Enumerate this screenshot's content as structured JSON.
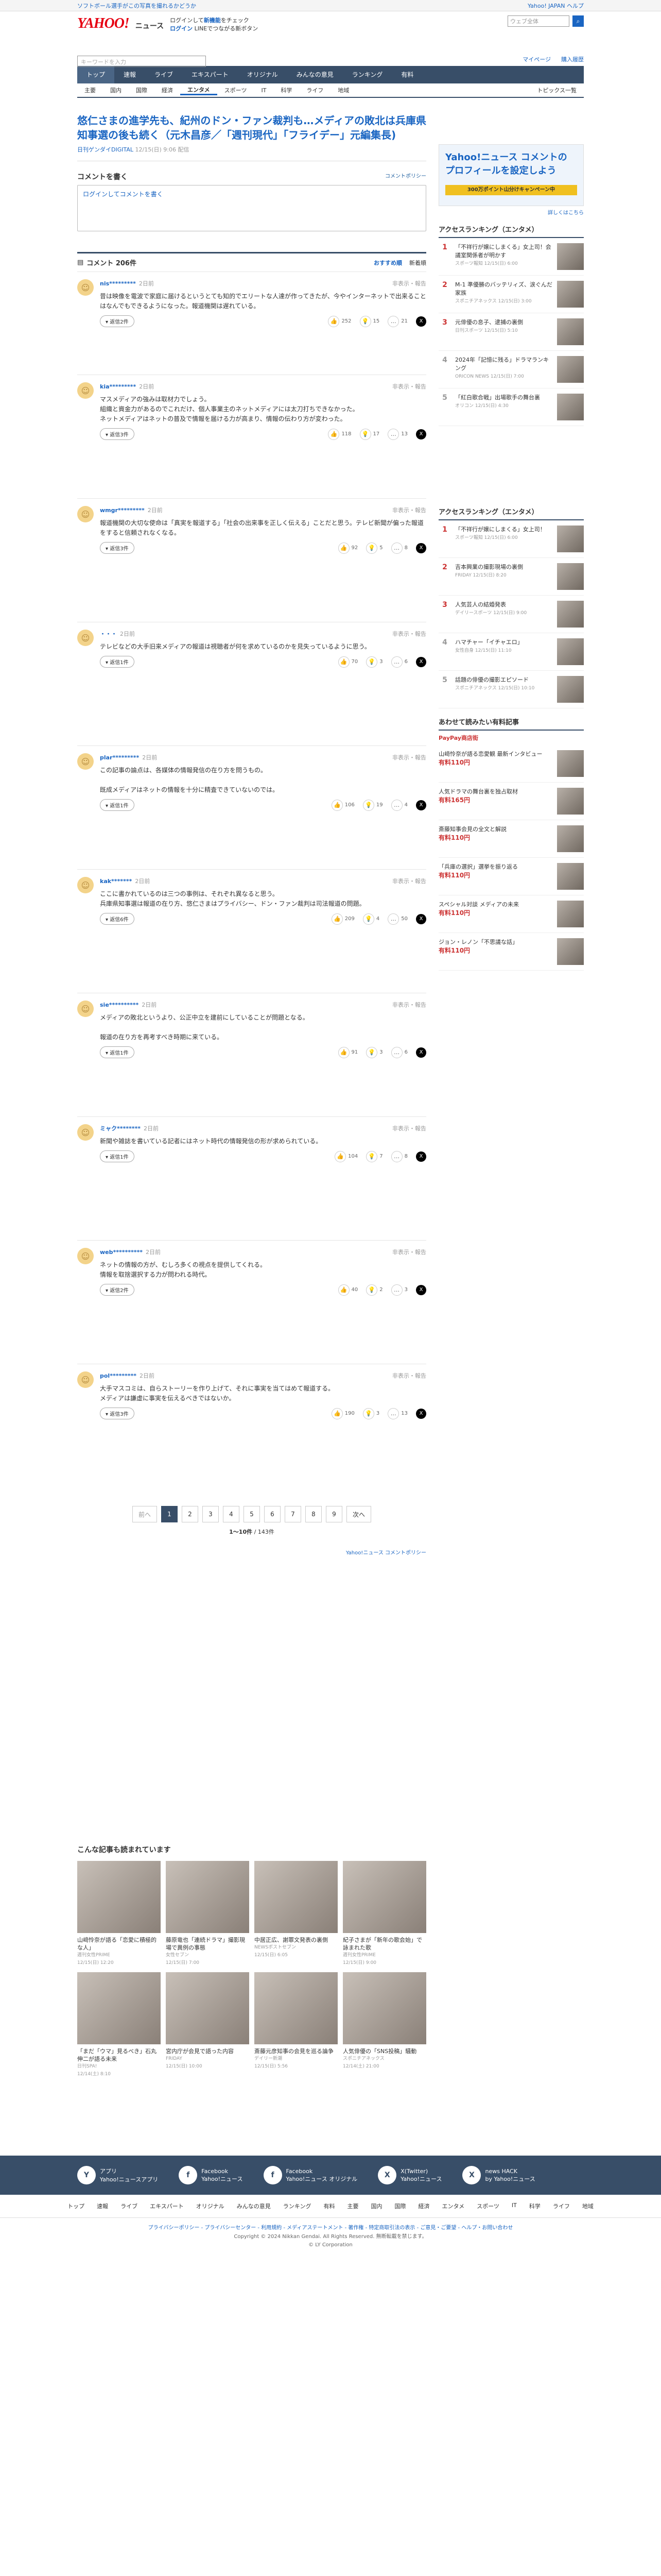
{
  "topbar": {
    "left": "ソフトボール選手がこの写真を撮れるかどうか",
    "right_login": "Yahoo! JAPAN ヘルプ",
    "search_placeholder": "ウェブ全体",
    "search_btn": "検索"
  },
  "header": {
    "logo": "YAHOO!",
    "logo_sub": "ニュース",
    "promo_line1": "ログインして",
    "promo_link1": "新機能",
    "promo_line2": "をチェック",
    "login": "ログイン",
    "login_note": "LINEでつながる新ボタン",
    "kw_label": "キーワード",
    "search_place": "キーワードを入力",
    "myhub": "マイページ",
    "reg": "購入履歴"
  },
  "nav": [
    "トップ",
    "速報",
    "ライブ",
    "エキスパート",
    "オリジナル",
    "みんなの意見",
    "ランキング",
    "有料"
  ],
  "cats": [
    "主要",
    "国内",
    "国際",
    "経済",
    "エンタメ",
    "スポーツ",
    "IT",
    "科学",
    "ライフ",
    "地域"
  ],
  "cats_right": "トピックス一覧",
  "article": {
    "title": "悠仁さまの進学先も、紀州のドン・ファン裁判も…メディアの敗北は兵庫県知事選の後も続く（元木昌彦／「週刊現代」「フライデー」元編集長)",
    "source": "日刊ゲンダイDIGITAL",
    "time": "12/15(日) 9:06 配信"
  },
  "comment_section": {
    "title": "コメントを書く",
    "policy": "コメントポリシー",
    "login_prompt": "ログインしてコメントを書く",
    "count_label": "コメント 206件",
    "sort1": "おすすめ順",
    "sort2": "新着順"
  },
  "comments": [
    {
      "user": "nis*********",
      "time": "2日前",
      "report": "非表示・報告",
      "text": "昔は映像を電波で家庭に届けるというとても知的でエリートな人達が作ってきたが、今やインターネットで出来ることはなんでもできるようになった。報道機関は遅れている。",
      "r1": "252",
      "r2": "15",
      "r3": "21",
      "replies": "返信2件"
    },
    {
      "user": "kia*********",
      "time": "2日前",
      "report": "非表示・報告",
      "text": "マスメディアの強みは取材力でしょう。\n組織と資金力があるのでこれだけ、個人事業主のネットメディアには太刀打ちできなかった。\nネットメディアはネットの普及で情報を届ける力が高まり、情報の伝わり方が変わった。",
      "r1": "118",
      "r2": "17",
      "r3": "13",
      "replies": "返信3件"
    },
    {
      "user": "wmgr*********",
      "time": "2日前",
      "report": "非表示・報告",
      "text": "報道機関の大切な使命は「真実を報道する」「社会の出来事を正しく伝える」ことだと思う。テレビ新聞が偏った報道をすると信頼されなくなる。",
      "r1": "92",
      "r2": "5",
      "r3": "8",
      "replies": "返信3件"
    },
    {
      "user": "・・・",
      "time": "2日前",
      "report": "非表示・報告",
      "text": "テレビなどの大手旧来メディアの報道は視聴者が何を求めているのかを見失っているように思う。",
      "r1": "70",
      "r2": "3",
      "r3": "6",
      "replies": "返信1件"
    },
    {
      "user": "plar*********",
      "time": "2日前",
      "report": "非表示・報告",
      "text": "この記事の論点は、各媒体の情報発信の在り方を問うもの。\n\n既成メディアはネットの情報を十分に精査できていないのでは。",
      "r1": "106",
      "r2": "19",
      "r3": "4",
      "replies": "返信1件"
    },
    {
      "user": "kak*******",
      "time": "2日前",
      "report": "非表示・報告",
      "text": "ここに書かれているのは三つの事例は、それぞれ異なると思う。\n兵庫県知事選は報道の在り方、悠仁さまはプライバシー、ドン・ファン裁判は司法報道の問題。",
      "r1": "209",
      "r2": "4",
      "r3": "50",
      "replies": "返信6件"
    },
    {
      "user": "sie**********",
      "time": "2日前",
      "report": "非表示・報告",
      "text": "メディアの敗北というより、公正中立を建前にしていることが問題となる。\n\n報道の在り方を再考すべき時期に来ている。",
      "r1": "91",
      "r2": "3",
      "r3": "6",
      "replies": "返信1件"
    },
    {
      "user": "ミャク********",
      "time": "2日前",
      "report": "非表示・報告",
      "text": "新聞や雑誌を書いている記者にはネット時代の情報発信の形が求められている。",
      "r1": "104",
      "r2": "7",
      "r3": "8",
      "replies": "返信1件"
    },
    {
      "user": "web**********",
      "time": "2日前",
      "report": "非表示・報告",
      "text": "ネットの情報の方が、むしろ多くの視点を提供してくれる。\n情報を取捨選択する力が問われる時代。",
      "r1": "40",
      "r2": "2",
      "r3": "3",
      "replies": "返信2件"
    },
    {
      "user": "pol*********",
      "time": "2日前",
      "report": "非表示・報告",
      "text": "大手マスコミは、自らストーリーを作り上げて、それに事実を当てはめて報道する。\nメディアは謙虚に事実を伝えるべきではないか。",
      "r1": "190",
      "r2": "3",
      "r3": "13",
      "replies": "返信3件"
    }
  ],
  "pager": {
    "prev": "前へ",
    "pages": [
      "1",
      "2",
      "3",
      "4",
      "5",
      "6",
      "7",
      "8",
      "9"
    ],
    "next": "次へ",
    "info_range": "1〜10件",
    "info_total": "/ 143件",
    "footer_link": "Yahoo!ニュース コメントポリシー"
  },
  "recommend": {
    "title": "こんな記事も読まれています",
    "items": [
      {
        "title": "山﨑怜奈が語る「恋愛に積極的な人」",
        "src": "週刊女性PRIME",
        "time": "12/15(日) 12:20"
      },
      {
        "title": "藤原竜也「連続ドラマ」撮影現場で異例の事態",
        "src": "女性セブン",
        "time": "12/15(日) 7:00"
      },
      {
        "title": "中居正広、謝罪文発表の裏側",
        "src": "NEWSポストセブン",
        "time": "12/15(日) 6:05"
      },
      {
        "title": "紀子さまが「新年の歌会始」で詠まれた歌",
        "src": "週刊女性PRIME",
        "time": "12/15(日) 9:00"
      },
      {
        "title": "「まだ「ウマ」見るべき」石丸伸二が語る未来",
        "src": "日刊SPA!",
        "time": "12/14(土) 8:10"
      },
      {
        "title": "宮内庁が会見で語った内容",
        "src": "FRIDAY",
        "time": "12/15(日) 10:00"
      },
      {
        "title": "斎藤元彦知事の会見を巡る論争",
        "src": "デイリー新潮",
        "time": "12/15(日) 5:56"
      },
      {
        "title": "人気俳優の「SNS投稿」騒動",
        "src": "スポニチアネックス",
        "time": "12/14(土) 21:00"
      }
    ]
  },
  "side": {
    "banner_title": "Yahoo!ニュース コメントの プロフィールを設定しよう",
    "banner_btn": "300万ポイント山分けキャンペーン中",
    "ad_link": "詳しくはこちら",
    "rank1_title": "アクセスランキング（エンタメ）",
    "rank1": [
      {
        "no": "1",
        "title": "「不祥行が嬢にしまくる」女上司！会議室関係者が明かす",
        "src": "スポーツ報知",
        "time": "12/15(日) 6:00"
      },
      {
        "no": "2",
        "title": "M-1 準優勝のバッテリィズ、涙ぐんだ家族",
        "src": "スポニチアネックス",
        "time": "12/15(日) 3:00"
      },
      {
        "no": "3",
        "title": "元俳優の息子、逮捕の裏側",
        "src": "日刊スポーツ",
        "time": "12/15(日) 5:10"
      },
      {
        "no": "4",
        "title": "2024年「記憶に残る」ドラマランキング",
        "src": "ORICON NEWS",
        "time": "12/15(日) 7:00"
      },
      {
        "no": "5",
        "title": "「紅白歌合戦」出場歌手の舞台裏",
        "src": "オリコン",
        "time": "12/15(日) 4:30"
      }
    ],
    "rank2_title": "アクセスランキング（エンタメ）",
    "rank2": [
      {
        "no": "1",
        "title": "「不祥行が嬢にしまくる」女上司！",
        "src": "スポーツ報知",
        "time": "12/15(日) 6:00"
      },
      {
        "no": "2",
        "title": "吉本興業の撮影現場の裏側",
        "src": "FRIDAY",
        "time": "12/15(日) 8:20"
      },
      {
        "no": "3",
        "title": "人気芸人の結婚発表",
        "src": "デイリースポーツ",
        "time": "12/15(日) 9:00"
      },
      {
        "no": "4",
        "title": "ハマチャー「イチャエロ」",
        "src": "女性自身",
        "time": "12/15(日) 11:10"
      },
      {
        "no": "5",
        "title": "話題の俳優の撮影エピソード",
        "src": "スポニチアネックス",
        "time": "12/15(日) 10:10"
      }
    ],
    "ad_title": "あわせて読みたい有料記事",
    "ad_brand": "PayPay商店街",
    "ads": [
      {
        "title": "山﨑怜奈が語る恋愛観 最新インタビュー",
        "price": "有料110円"
      },
      {
        "title": "人気ドラマの舞台裏を独占取材",
        "price": "有料165円"
      },
      {
        "title": "斎藤知事会見の全文と解説",
        "price": "有料110円"
      },
      {
        "title": "「兵庫の選択」選挙を振り返る",
        "price": "有料110円"
      },
      {
        "title": "スペシャル対談 メディアの未来",
        "price": "有料110円"
      },
      {
        "title": "ジョン・レノン「不思議な話」",
        "price": "有料110円"
      }
    ]
  },
  "footer": {
    "apps": [
      {
        "icon": "Y",
        "label": "アプリ",
        "sub": "Yahoo!ニュースアプリ"
      },
      {
        "icon": "f",
        "label": "Facebook",
        "sub": "Yahoo!ニュース"
      },
      {
        "icon": "f",
        "label": "Facebook",
        "sub": "Yahoo!ニュース オリジナル"
      },
      {
        "icon": "X",
        "label": "X(Twitter)",
        "sub": "Yahoo!ニュース"
      },
      {
        "icon": "X",
        "label": "news HACK",
        "sub": "by Yahoo!ニュース"
      }
    ],
    "nav": [
      "トップ",
      "速報",
      "ライブ",
      "エキスパート",
      "オリジナル",
      "みんなの意見",
      "ランキング",
      "有料",
      "主要",
      "国内",
      "国際",
      "経済",
      "エンタメ",
      "スポーツ",
      "IT",
      "科学",
      "ライフ",
      "地域"
    ],
    "links": "プライバシーポリシー - プライバシーセンター - 利用規約 - メディアステートメント - 著作権 - 特定商取引法の表示 - ご意見・ご要望 - ヘルプ・お問い合わせ",
    "copy1": "Copyright © 2024 Nikkan Gendai. All Rights Reserved. 無断転載を禁じます。",
    "copy2": "© LY Corporation"
  }
}
